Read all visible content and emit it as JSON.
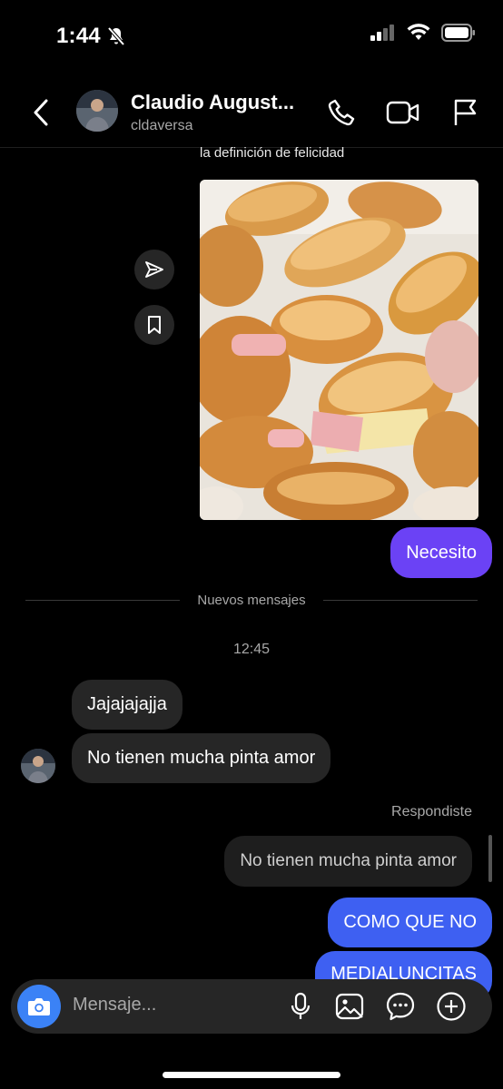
{
  "status_bar": {
    "time": "1:44",
    "icons": [
      "bell-slash-icon",
      "cellular-signal-icon",
      "wifi-icon",
      "battery-icon"
    ]
  },
  "header": {
    "name": "Claudio August...",
    "username": "cldaversa",
    "icons": [
      "chevron-left-icon",
      "phone-icon",
      "video-camera-icon",
      "flag-icon"
    ]
  },
  "conversation": {
    "shared_post_caption": "la definición de felicidad",
    "shared_post_image": "photo of ham and cheese croissants in a box",
    "messages": {
      "necesito": "Necesito",
      "jajaja": "Jajajajajja",
      "no_tienen": "No tienen mucha pinta amor",
      "replied_label": "Respondiste",
      "replied_quote": "No tienen mucha pinta amor",
      "como_que_no": "COMO QUE NO",
      "medialuncitas": "MEDIALUNCITAS"
    },
    "new_messages_divider": "Nuevos mensajes",
    "timestamp": "12:45"
  },
  "composer": {
    "placeholder": "Mensaje...",
    "icons": [
      "camera-icon",
      "microphone-icon",
      "image-icon",
      "chat-bubble-icon",
      "plus-circle-icon"
    ]
  },
  "colors": {
    "background": "#000000",
    "sent_bubble_purple": "#6b42f5",
    "sent_bubble_blue": "#3e60f2",
    "received_bubble": "#262626",
    "camera_button": "#3b82f6"
  }
}
